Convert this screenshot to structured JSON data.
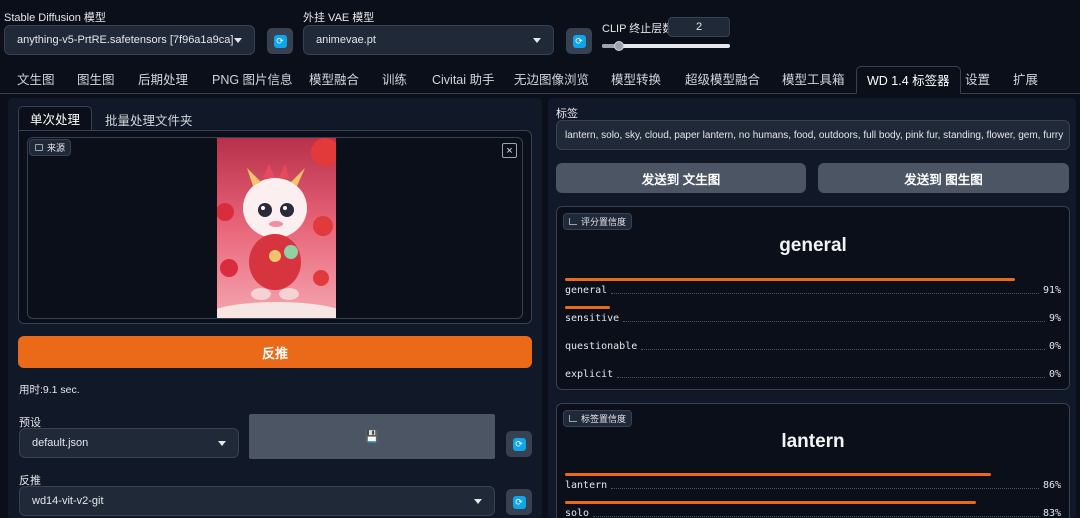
{
  "top": {
    "sd_model_label": "Stable Diffusion 模型",
    "sd_model_value": "anything-v5-PrtRE.safetensors [7f96a1a9ca]",
    "vae_label": "外挂 VAE 模型",
    "vae_value": "animevae.pt",
    "clip_label": "CLIP 终止层数",
    "clip_value": "2",
    "clip_slider_level": 0.1
  },
  "tabs": [
    {
      "label": "文生图"
    },
    {
      "label": "图生图"
    },
    {
      "label": "后期处理"
    },
    {
      "label": "PNG 图片信息"
    },
    {
      "label": "模型融合"
    },
    {
      "label": "训练"
    },
    {
      "label": "Civitai 助手"
    },
    {
      "label": "无边图像浏览"
    },
    {
      "label": "模型转换"
    },
    {
      "label": "超级模型融合"
    },
    {
      "label": "模型工具箱"
    },
    {
      "label": "WD 1.4 标签器"
    },
    {
      "label": "设置"
    },
    {
      "label": "扩展"
    }
  ],
  "left": {
    "subtab_single": "单次处理",
    "subtab_batch": "批量处理文件夹",
    "source_label": "来源",
    "close_glyph": "×",
    "interrogate_button": "反推",
    "time_text": "用时:9.1 sec.",
    "preset_label": "预设",
    "preset_value": "default.json",
    "save_glyph": "💾",
    "interrogator_label": "反推",
    "interrogator_value": "wd14-vit-v2-git"
  },
  "right": {
    "tags_label": "标签",
    "tags_value": "lantern, solo, sky, cloud, paper lantern, no humans, food, outdoors, full body, pink fur, standing, flower, gem, furry",
    "send_txt2img": "发送到 文生图",
    "send_img2img": "发送到 图生图",
    "rating_chip": "评分置信度",
    "rating_title": "general",
    "ratings": [
      {
        "name": "general",
        "pct": "91%",
        "value": 0.91
      },
      {
        "name": "sensitive",
        "pct": "9%",
        "value": 0.09
      },
      {
        "name": "questionable",
        "pct": "0%",
        "value": 0.0
      },
      {
        "name": "explicit",
        "pct": "0%",
        "value": 0.0
      }
    ],
    "tag_chip": "标签置信度",
    "tag_title": "lantern",
    "tags": [
      {
        "name": "lantern",
        "pct": "86%",
        "value": 0.86
      },
      {
        "name": "solo",
        "pct": "83%",
        "value": 0.83
      }
    ]
  },
  "colors": {
    "accent": "#ea6a1a",
    "refresh": "#0ea5e9",
    "bg": "#0b0f19"
  }
}
